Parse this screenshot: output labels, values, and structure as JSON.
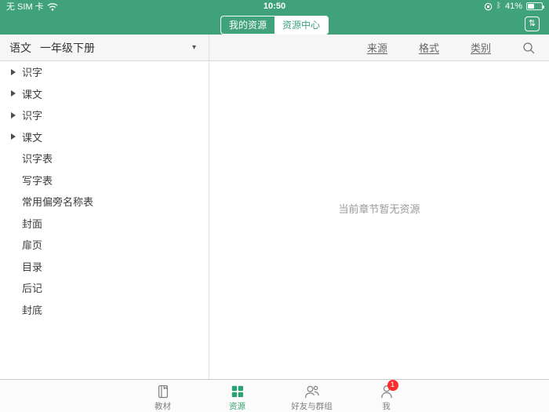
{
  "status_bar": {
    "carrier": "无 SIM 卡",
    "time": "10:50",
    "battery_percent": "41%"
  },
  "nav": {
    "segments": [
      {
        "label": "我的资源",
        "selected": false
      },
      {
        "label": "资源中心",
        "selected": true
      }
    ],
    "transfer_icon": "transfer-arrows"
  },
  "header": {
    "book_subject": "语文",
    "book_title": "一年级下册",
    "filters": [
      {
        "label": "来源"
      },
      {
        "label": "格式"
      },
      {
        "label": "类别"
      }
    ],
    "search_icon": "magnifier"
  },
  "sidebar": {
    "items": [
      {
        "label": "识字",
        "expandable": true
      },
      {
        "label": "课文",
        "expandable": true
      },
      {
        "label": "识字",
        "expandable": true
      },
      {
        "label": "课文",
        "expandable": true
      },
      {
        "label": "识字表",
        "expandable": false
      },
      {
        "label": "写字表",
        "expandable": false
      },
      {
        "label": "常用偏旁名称表",
        "expandable": false
      },
      {
        "label": "封面",
        "expandable": false
      },
      {
        "label": "扉页",
        "expandable": false
      },
      {
        "label": "目录",
        "expandable": false
      },
      {
        "label": "后记",
        "expandable": false
      },
      {
        "label": "封底",
        "expandable": false
      }
    ]
  },
  "content": {
    "empty_message": "当前章节暂无资源"
  },
  "tab_bar": {
    "tabs": [
      {
        "label": "教材",
        "icon": "book-icon",
        "active": false
      },
      {
        "label": "资源",
        "icon": "grid-icon",
        "active": true
      },
      {
        "label": "好友与群组",
        "icon": "people-icon",
        "active": false
      },
      {
        "label": "我",
        "icon": "person-icon",
        "active": false,
        "badge": "1"
      }
    ]
  },
  "colors": {
    "accent_green": "#40a27b",
    "badge_red": "#f92f2f"
  }
}
